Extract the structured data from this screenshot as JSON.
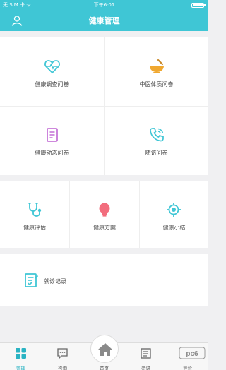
{
  "status_bar": {
    "carrier": "无 SIM 卡 ᯤ",
    "time": "下午6:01"
  },
  "header": {
    "title": "健康管理",
    "user_icon": "user-icon"
  },
  "grid_top": [
    {
      "label": "健康调查问卷",
      "icon": "heart-pulse-icon",
      "color": "#3fc6d5"
    },
    {
      "label": "中医体质问卷",
      "icon": "herbal-bowl-icon",
      "color": "#f0a830"
    },
    {
      "label": "健康动态问卷",
      "icon": "document-icon",
      "color": "#c777d8"
    },
    {
      "label": "随访问卷",
      "icon": "phone-icon",
      "color": "#3fc6d5"
    }
  ],
  "grid_middle": [
    {
      "label": "健康评估",
      "icon": "stethoscope-icon",
      "color": "#3fc6d5"
    },
    {
      "label": "健康方案",
      "icon": "lightbulb-icon",
      "color": "#f26d7d"
    },
    {
      "label": "健康小结",
      "icon": "target-icon",
      "color": "#3fc6d5"
    }
  ],
  "records": {
    "label": "就诊记录",
    "icon": "clipboard-icon",
    "color": "#3fc6d5"
  },
  "tabbar": {
    "tabs": [
      {
        "label": "管理",
        "icon": "grid-icon",
        "active": true
      },
      {
        "label": "咨询",
        "icon": "chat-icon",
        "active": false
      },
      {
        "label": "首页",
        "icon": "home-icon",
        "active": false
      },
      {
        "label": "资讯",
        "icon": "news-icon",
        "active": false
      },
      {
        "label": "导诊",
        "icon": "guide-icon",
        "active": false
      }
    ]
  },
  "colors": {
    "accent": "#3fc6d5",
    "background": "#f0f0f2"
  },
  "watermark": "pc6"
}
